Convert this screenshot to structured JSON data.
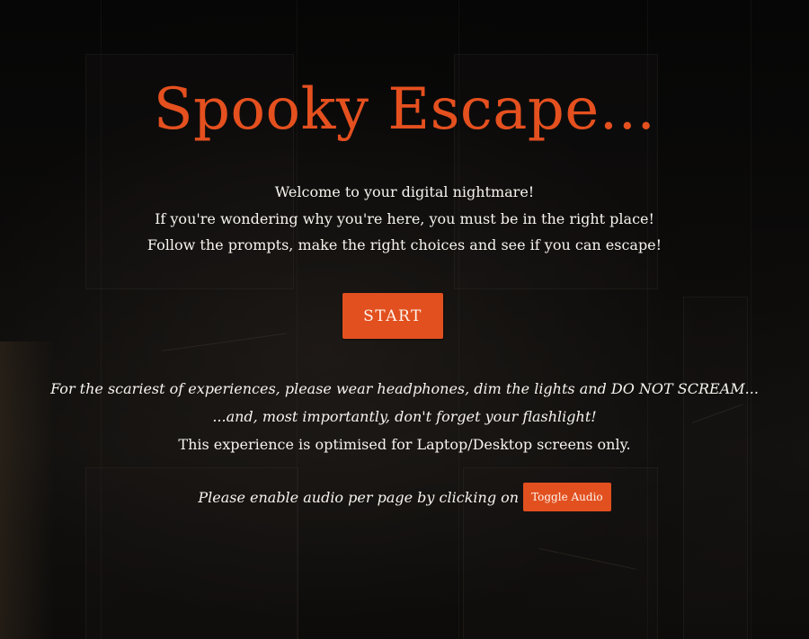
{
  "page": {
    "title": "Spooky Escape...",
    "intro_lines": [
      "Welcome to your digital nightmare!",
      "If you're wondering why you're here, you must be in the right place!",
      "Follow the prompts, make the right choices and see if you can escape!"
    ],
    "start_label": "START",
    "notice_lines": [
      "For the scariest of experiences, please wear headphones, dim the lights and DO NOT SCREAM...",
      "...and, most importantly, don't forget your flashlight!",
      "This experience is optimised for Laptop/Desktop screens only."
    ],
    "audio_prompt": "Please enable audio per page by clicking on",
    "toggle_audio_label": "Toggle Audio"
  },
  "colors": {
    "accent": "#e2501f",
    "background": "#050505",
    "text": "#f7f4ef"
  }
}
